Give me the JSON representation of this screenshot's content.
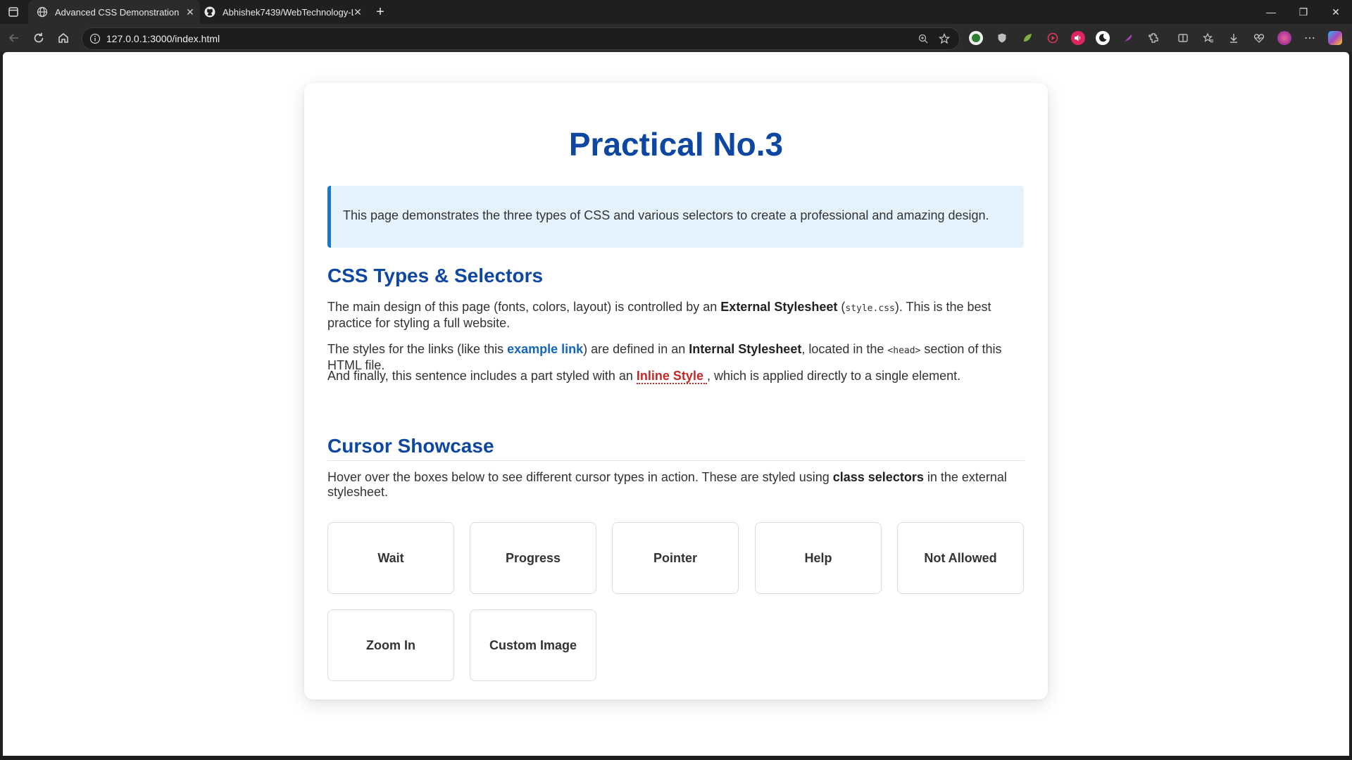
{
  "browser": {
    "tabs": [
      {
        "title": "Advanced CSS Demonstration",
        "active": true
      },
      {
        "title": "Abhishek7439/WebTechnology-L",
        "active": false
      }
    ],
    "url": "127.0.0.1:3000/index.html",
    "extension_icons": [
      "adblock-icon",
      "shield-icon",
      "leaf-icon",
      "record-icon",
      "volume-icon",
      "moon-icon",
      "feather-icon",
      "extensions-icon",
      "split-screen-icon",
      "favorites-icon",
      "downloads-icon",
      "heartbeat-icon",
      "profile-avatar",
      "more-icon",
      "copilot-icon"
    ]
  },
  "page": {
    "title": "Practical No.3",
    "intro": "This page demonstrates the three types of CSS and various selectors to create a professional and amazing design.",
    "section1": {
      "heading": "CSS Types & Selectors",
      "p1_a": "The main design of this page (fonts, colors, layout) is controlled by an ",
      "p1_bold": "External Stylesheet",
      "p1_b": " (",
      "p1_code": "style.css",
      "p1_c": "). This is the best practice for styling a full website.",
      "p2_a": "The styles for the links (like this ",
      "p2_link": "example link",
      "p2_b": ") are defined in an ",
      "p2_bold": "Internal Stylesheet",
      "p2_c": ", located in the ",
      "p2_code": "<head>",
      "p2_d": " section of this HTML file.",
      "p3_a": "And finally, this sentence includes a part styled with an ",
      "p3_inline": "Inline Style ",
      "p3_b": ", which is applied directly to a single element."
    },
    "section2": {
      "heading": "Cursor Showcase",
      "p_a": "Hover over the boxes below to see different cursor types in action. These are styled using ",
      "p_bold": "class selectors",
      "p_b": " in the external stylesheet.",
      "boxes": [
        "Wait",
        "Progress",
        "Pointer",
        "Help",
        "Not Allowed",
        "Zoom In",
        "Custom Image"
      ]
    }
  },
  "colors": {
    "heading": "#0d47a1",
    "link": "#1565c0",
    "inline": "#c62828",
    "intro_bg": "#e3f2fd",
    "intro_border": "#1976d2"
  }
}
